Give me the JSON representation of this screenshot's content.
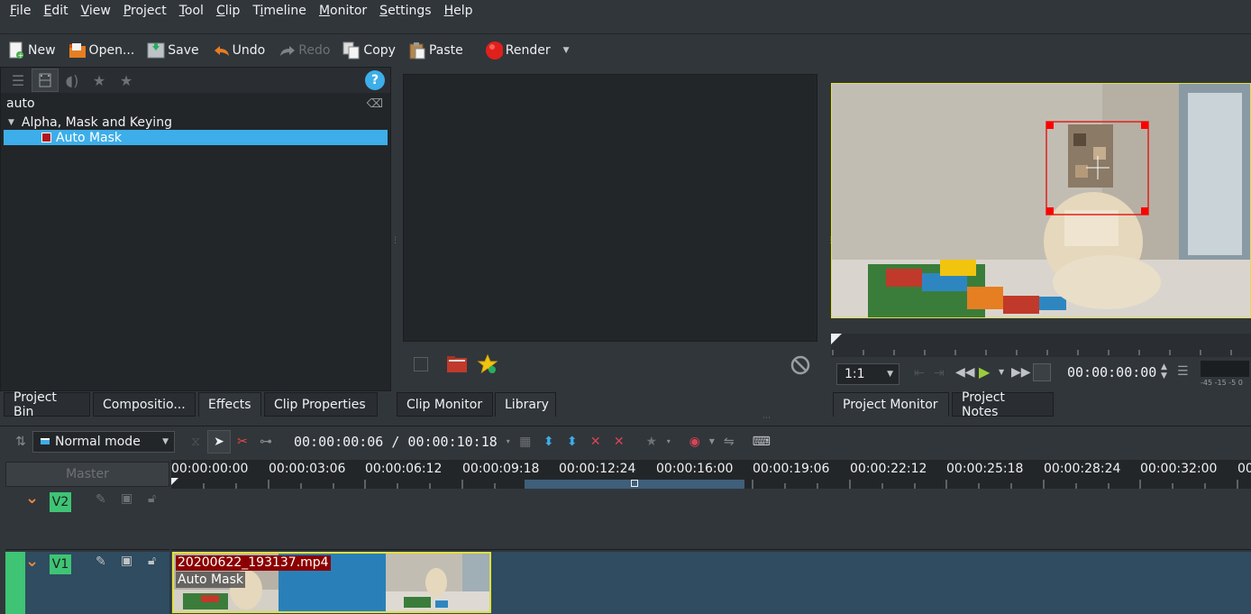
{
  "menu": {
    "items": [
      "File",
      "Edit",
      "View",
      "Project",
      "Tool",
      "Clip",
      "Timeline",
      "Monitor",
      "Settings",
      "Help"
    ],
    "mnemonics": [
      "F",
      "E",
      "V",
      "P",
      "T",
      "C",
      "i",
      "M",
      "S",
      "H"
    ]
  },
  "toolbar": {
    "new": "New",
    "open": "Open...",
    "save": "Save",
    "undo": "Undo",
    "redo": "Redo",
    "copy": "Copy",
    "paste": "Paste",
    "render": "Render"
  },
  "effects": {
    "search_value": "auto",
    "category": "Alpha, Mask and Keying",
    "selected_item": "Auto Mask",
    "help": "?"
  },
  "bottom_tabs": {
    "project_bin": "Project Bin",
    "compositions": "Compositio...",
    "effects": "Effects",
    "clip_properties": "Clip Properties",
    "clip_monitor": "Clip Monitor",
    "library": "Library",
    "project_monitor": "Project Monitor",
    "project_notes": "Project Notes"
  },
  "project_monitor": {
    "zoom": "1:1",
    "timecode": "00:00:00:00",
    "audio_scale": "-45 -15 -5 0"
  },
  "timeline": {
    "mode": "Normal mode",
    "position": "00:00:00:06 / 00:00:10:18",
    "master": "Master",
    "ruler": [
      "00:00:00:00",
      "00:00:03:06",
      "00:00:06:12",
      "00:00:09:18",
      "00:00:12:24",
      "00:00:16:00",
      "00:00:19:06",
      "00:00:22:12",
      "00:00:25:18",
      "00:00:28:24",
      "00:00:32:00",
      "00:0"
    ],
    "tracks": [
      {
        "name": "V2"
      },
      {
        "name": "V1"
      }
    ],
    "clip": {
      "name": "20200622_193137.mp4",
      "effect": "Auto Mask"
    }
  },
  "colors": {
    "accent": "#3daee9",
    "track_active": "#3ec474",
    "clip": "#2980b9",
    "clip_border": "#e0e040"
  }
}
